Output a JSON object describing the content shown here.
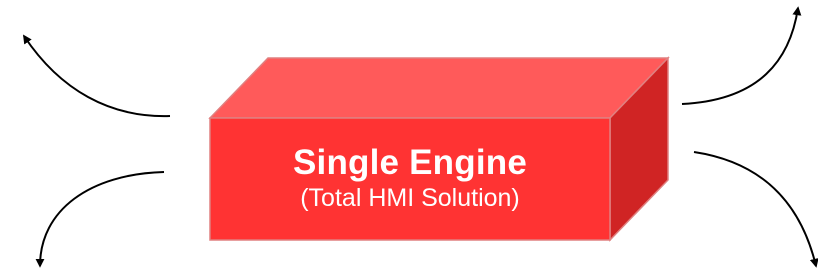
{
  "engine_box": {
    "title": "Single Engine",
    "subtitle": "(Total HMI Solution)",
    "colors": {
      "front": "#ff3333",
      "top": "#ff5a5a",
      "side": "#d02424",
      "edge": "#e08080",
      "text": "#ffffff",
      "arrow": "#000000"
    }
  }
}
